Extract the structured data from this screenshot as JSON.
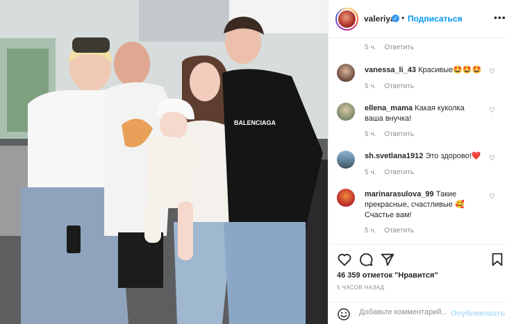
{
  "post": {
    "photo_icon": "family-photo",
    "username": "valeriya",
    "follow_label": "Подписаться",
    "more_icon": "more-icon"
  },
  "comments": [
    {
      "username": "",
      "text": "",
      "age": "5 ч.",
      "reply": "Ответить"
    },
    {
      "username": "vanessa_li_43",
      "text": "Красивые🤩🤩🤩",
      "age": "5 ч.",
      "reply": "Ответить"
    },
    {
      "username": "ellena_mama",
      "text": "Какая куколка ваша внучка!",
      "age": "5 ч.",
      "reply": "Ответить"
    },
    {
      "username": "sh.svetlana1912",
      "text": "Это здорово!❤️",
      "age": "5 ч.",
      "reply": "Ответить"
    },
    {
      "username": "marinarasulova_99",
      "text": "Такие прекрасные, счастливые 🥰 Счастье вам!",
      "age": "5 ч.",
      "reply": "Ответить"
    }
  ],
  "actions": {
    "likes": "46 359 отметок \"Нравится\"",
    "time_ago": "5 часов назад",
    "comment_placeholder": "Добавьте комментарий...",
    "publish_label": "Опубликовать"
  },
  "colors": {
    "accent": "#0095f6",
    "publish_disabled": "#b2dffc",
    "secondary_text": "#8e8e8e",
    "heart_red": "#ed4956"
  }
}
